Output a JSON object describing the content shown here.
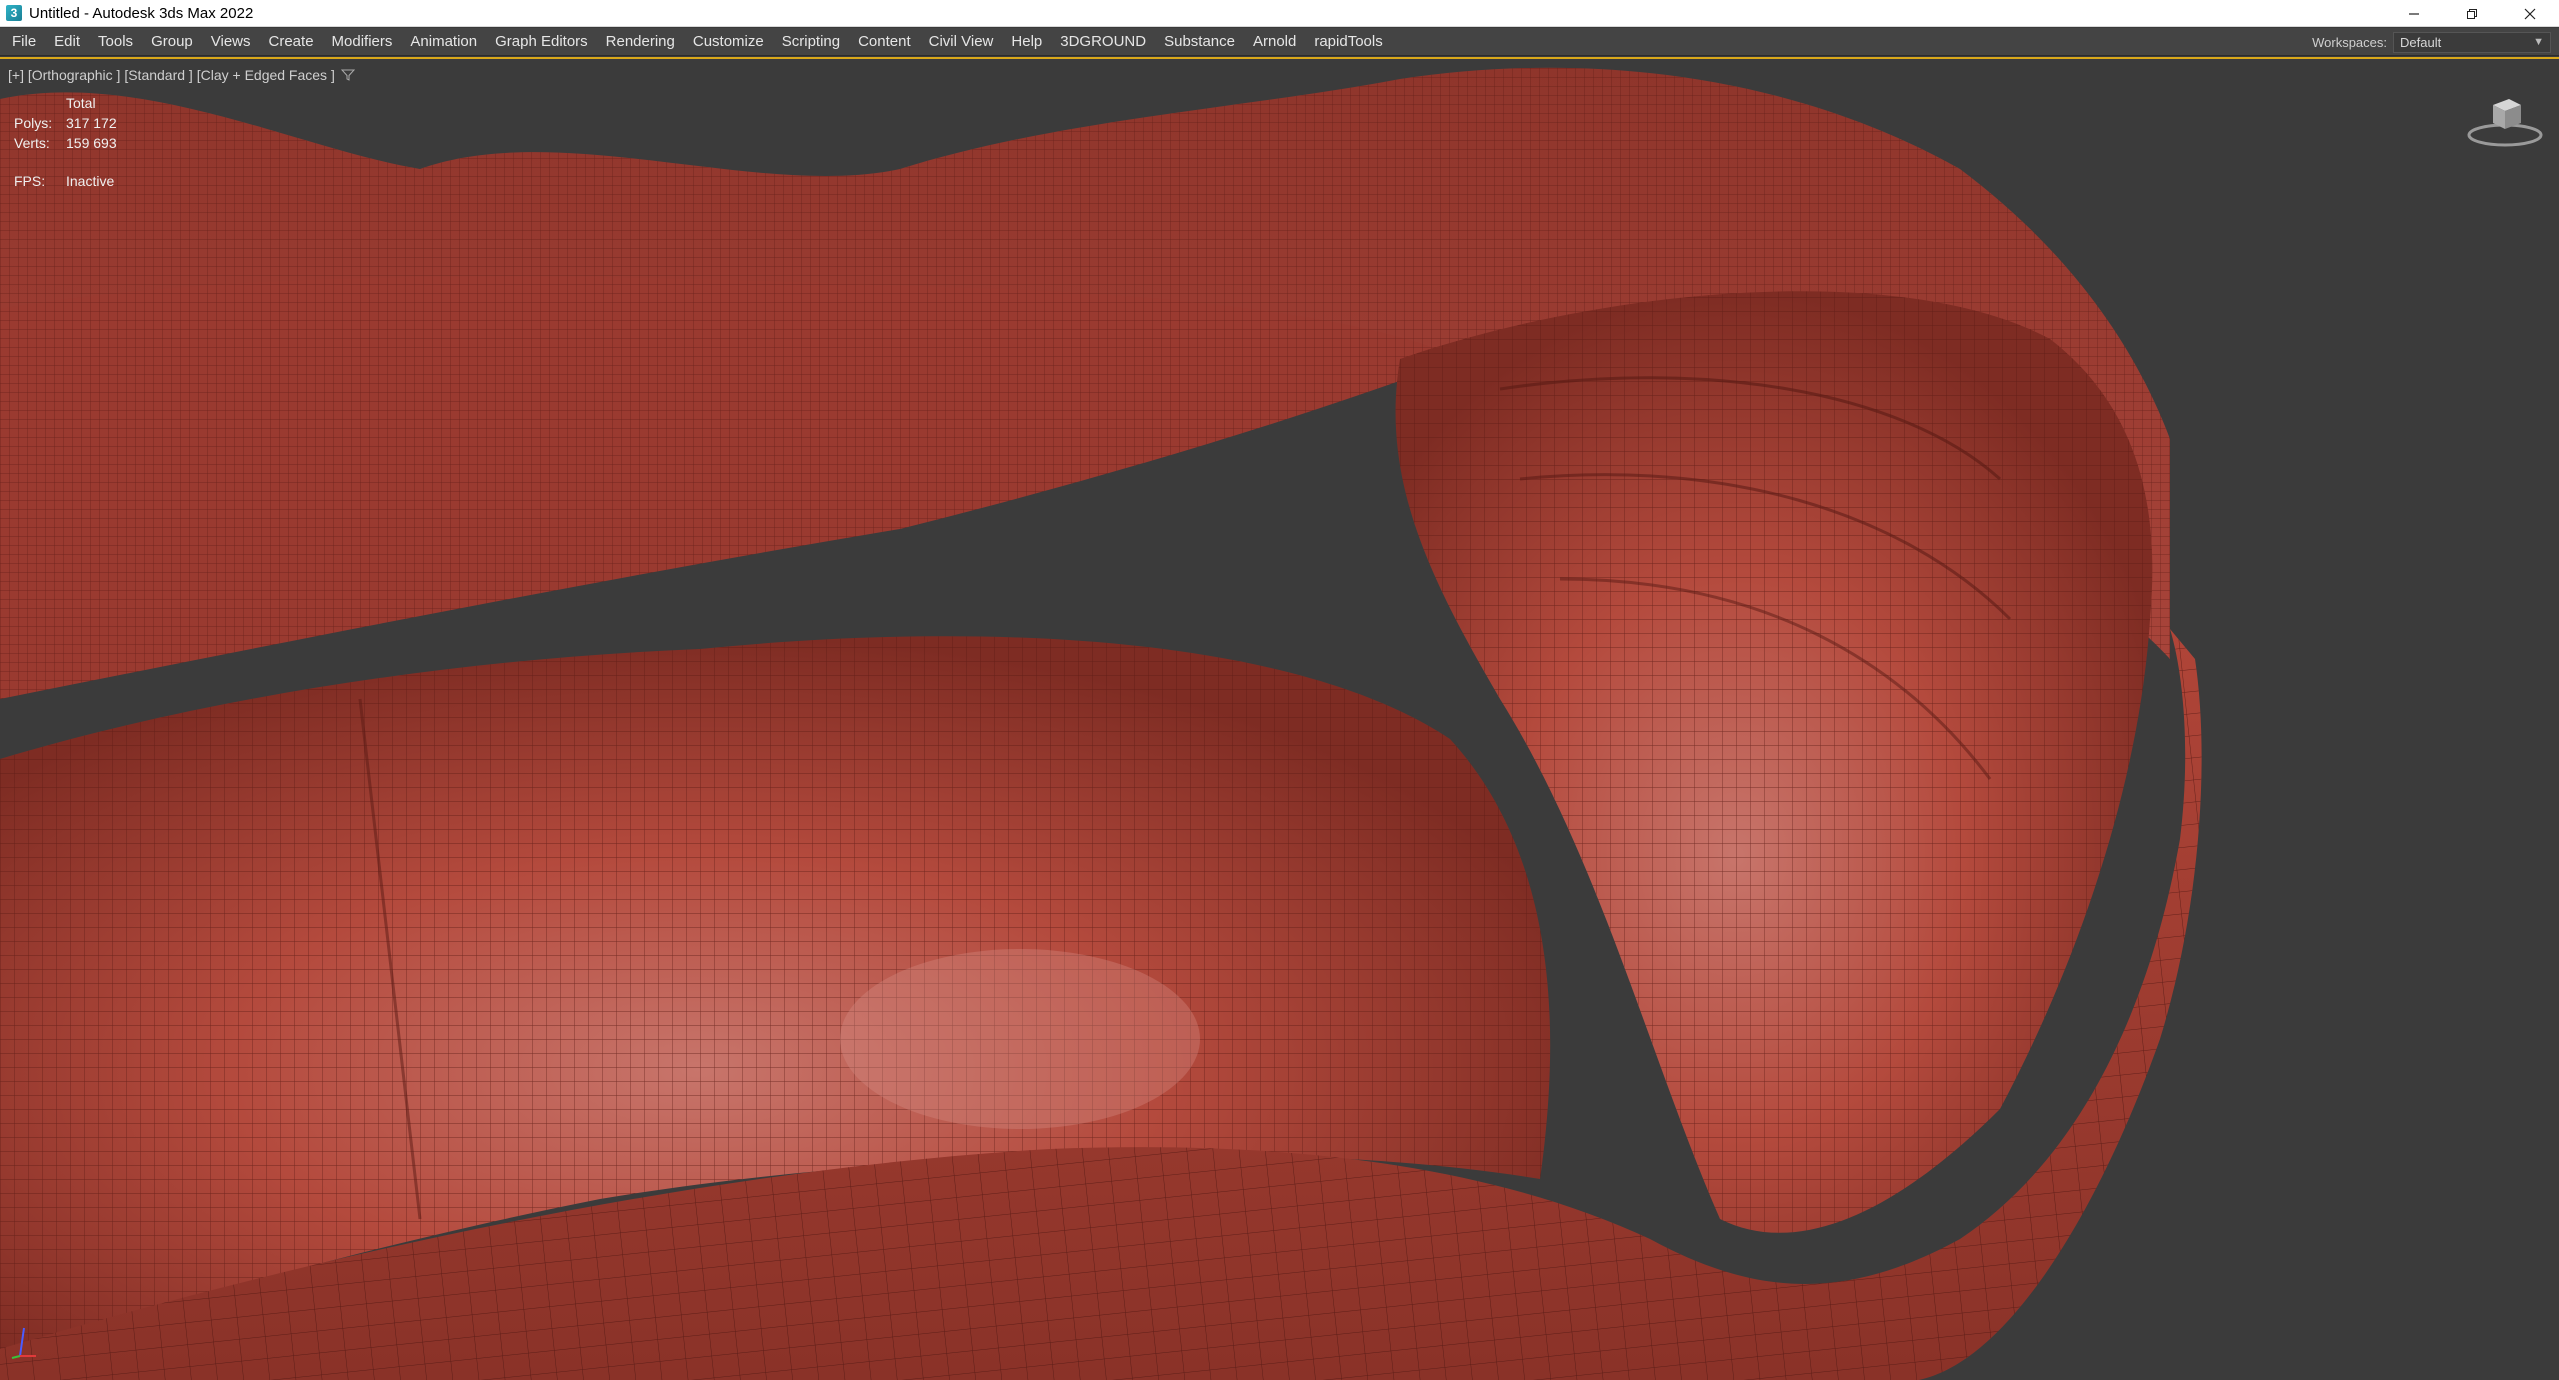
{
  "window": {
    "title": "Untitled - Autodesk 3ds Max 2022",
    "app_icon_letter": "3"
  },
  "menu": {
    "items": [
      "File",
      "Edit",
      "Tools",
      "Group",
      "Views",
      "Create",
      "Modifiers",
      "Animation",
      "Graph Editors",
      "Rendering",
      "Customize",
      "Scripting",
      "Content",
      "Civil View",
      "Help",
      "3DGROUND",
      "Substance",
      "Arnold",
      "rapidTools"
    ]
  },
  "workspaces": {
    "label": "Workspaces:",
    "value": "Default"
  },
  "viewport": {
    "label": "[+] [Orthographic ] [Standard ] [Clay + Edged Faces ]",
    "stats": {
      "header": "Total",
      "polys_label": "Polys:",
      "polys_value": "317 172",
      "verts_label": "Verts:",
      "verts_value": "159 693",
      "fps_label": "FPS:",
      "fps_value": "Inactive"
    }
  },
  "colors": {
    "mesh_red": "#b5463a",
    "mesh_dark": "#7a2a22",
    "viewport_bg": "#3b3b3b",
    "active_border": "#d9a81a"
  }
}
